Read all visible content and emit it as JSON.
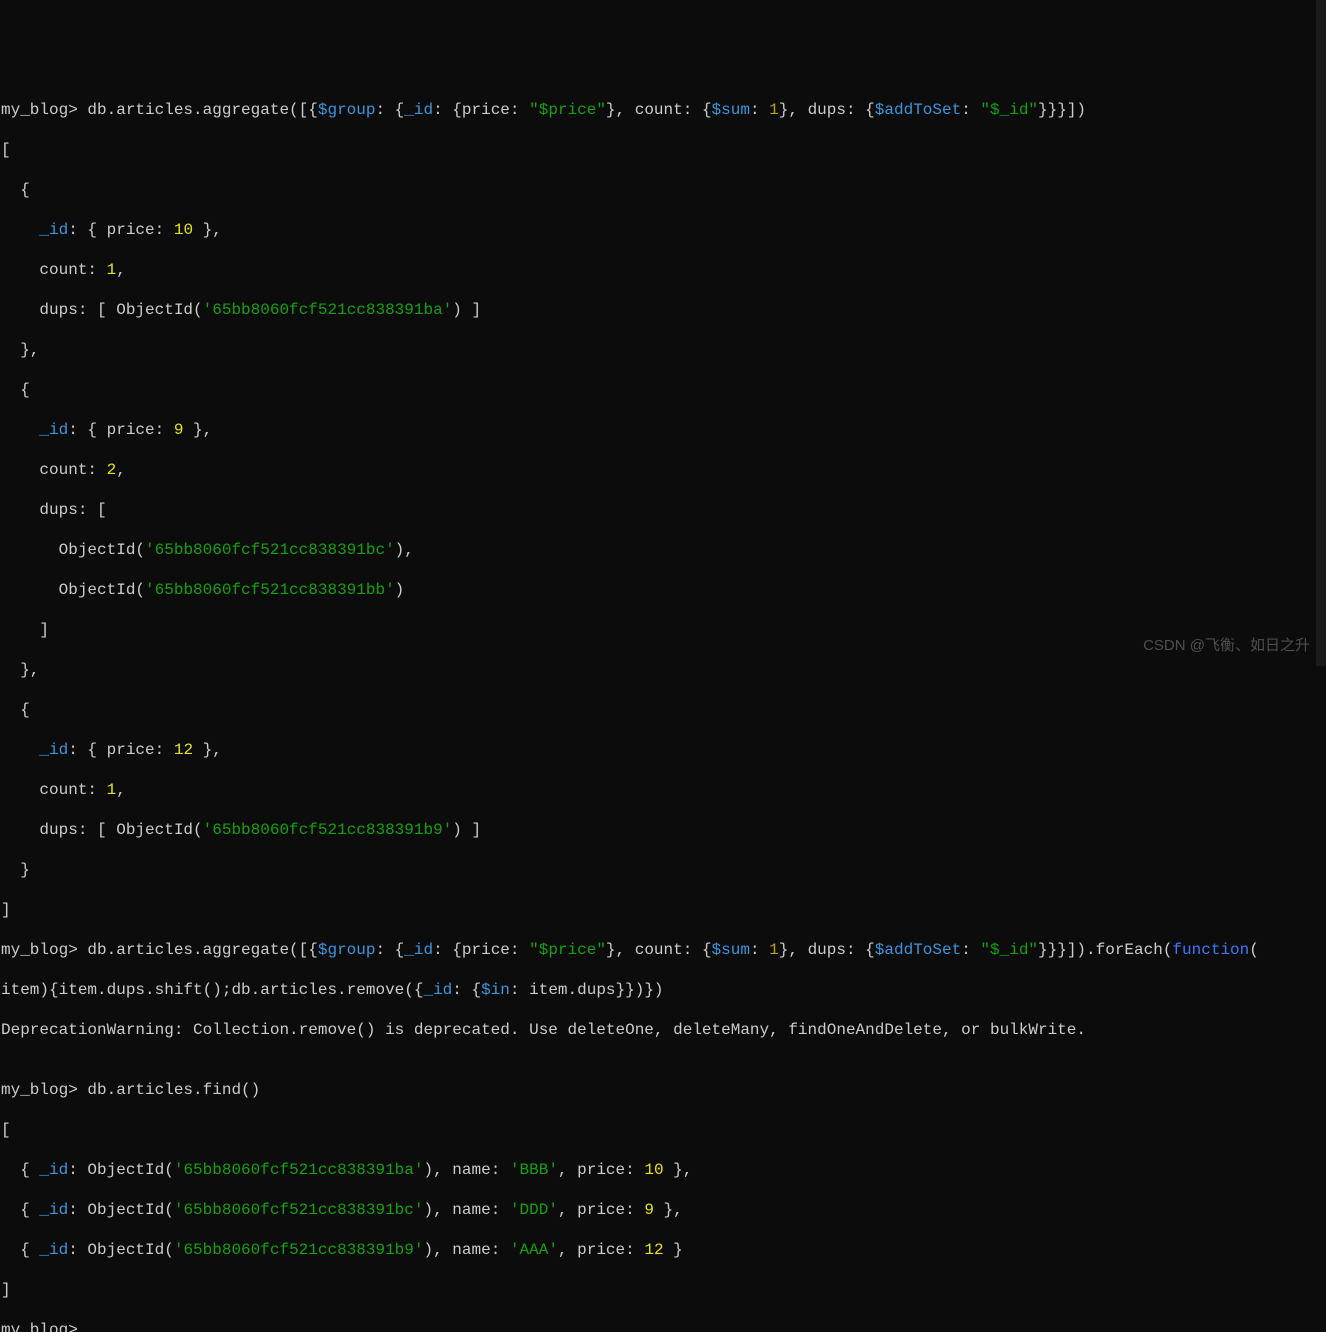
{
  "prompt": "my_blog>",
  "cmd1": {
    "prefix": " db.articles.aggregate([{",
    "dollar_group": "$group",
    "mid1": ": {",
    "field_id": "_id",
    "mid2": ": {price: ",
    "price_str": "\"$price\"",
    "mid3": "}, count: {",
    "dollar_sum": "$sum",
    "mid4": ": ",
    "one": "1",
    "mid5": "}, dups: {",
    "dollar_addToSet": "$addToSet",
    "mid6": ": ",
    "id_str": "\"$_id\"",
    "mid7": "}}}])"
  },
  "out1": {
    "l1": "[",
    "l2": "  {",
    "l3a": "    ",
    "l3_id": "_id",
    "l3b": ": { price: ",
    "l3_val": "10",
    "l3c": " },",
    "l4a": "    count: ",
    "l4_val": "1",
    "l4b": ",",
    "l5a": "    dups: [ ObjectId(",
    "l5_oid": "'65bb8060fcf521cc838391ba'",
    "l5b": ") ]",
    "l6": "  },",
    "l7": "  {",
    "l8a": "    ",
    "l8_id": "_id",
    "l8b": ": { price: ",
    "l8_val": "9",
    "l8c": " },",
    "l9a": "    count: ",
    "l9_val": "2",
    "l9b": ",",
    "l10": "    dups: [",
    "l11a": "      ObjectId(",
    "l11_oid": "'65bb8060fcf521cc838391bc'",
    "l11b": "),",
    "l12a": "      ObjectId(",
    "l12_oid": "'65bb8060fcf521cc838391bb'",
    "l12b": ")",
    "l13": "    ]",
    "l14": "  },",
    "l15": "  {",
    "l16a": "    ",
    "l16_id": "_id",
    "l16b": ": { price: ",
    "l16_val": "12",
    "l16c": " },",
    "l17a": "    count: ",
    "l17_val": "1",
    "l17b": ",",
    "l18a": "    dups: [ ObjectId(",
    "l18_oid": "'65bb8060fcf521cc838391b9'",
    "l18b": ") ]",
    "l19": "  }",
    "l20": "]"
  },
  "cmd2": {
    "l1_prefix": " db.articles.aggregate([{",
    "dollar_group": "$group",
    "m1": ": {",
    "field_id": "_id",
    "m2": ": {price: ",
    "price_str": "\"$price\"",
    "m3": "}, count: {",
    "dollar_sum": "$sum",
    "m4": ": ",
    "one": "1",
    "m5": "}, dups: {",
    "dollar_addToSet": "$addToSet",
    "m6": ": ",
    "id_str": "\"$_id\"",
    "m7": "}}}]).forEach(",
    "function": "function",
    "m8": "(",
    "l2_prefix": "item){item.dups.shift();db.articles.remove({",
    "field_id2": "_id",
    "m9": ": {",
    "dollar_in": "$in",
    "m10": ": item.dups}})})"
  },
  "warn": "DeprecationWarning: Collection.remove() is deprecated. Use deleteOne, deleteMany, findOneAndDelete, or bulkWrite.",
  "blank": "",
  "cmd3": " db.articles.find()",
  "out3": {
    "l1": "[",
    "r1a": "  { ",
    "r1_id": "_id",
    "r1b": ": ObjectId(",
    "r1_oid": "'65bb8060fcf521cc838391ba'",
    "r1c": "), name: ",
    "r1_name": "'BBB'",
    "r1d": ", price: ",
    "r1_price": "10",
    "r1e": " },",
    "r2a": "  { ",
    "r2_id": "_id",
    "r2b": ": ObjectId(",
    "r2_oid": "'65bb8060fcf521cc838391bc'",
    "r2c": "), name: ",
    "r2_name": "'DDD'",
    "r2d": ", price: ",
    "r2_price": "9",
    "r2e": " },",
    "r3a": "  { ",
    "r3_id": "_id",
    "r3b": ": ObjectId(",
    "r3_oid": "'65bb8060fcf521cc838391b9'",
    "r3c": "), name: ",
    "r3_name": "'AAA'",
    "r3d": ", price: ",
    "r3_price": "12",
    "r3e": " }",
    "l5": "]"
  },
  "watermark": "CSDN @飞衡、如日之升"
}
